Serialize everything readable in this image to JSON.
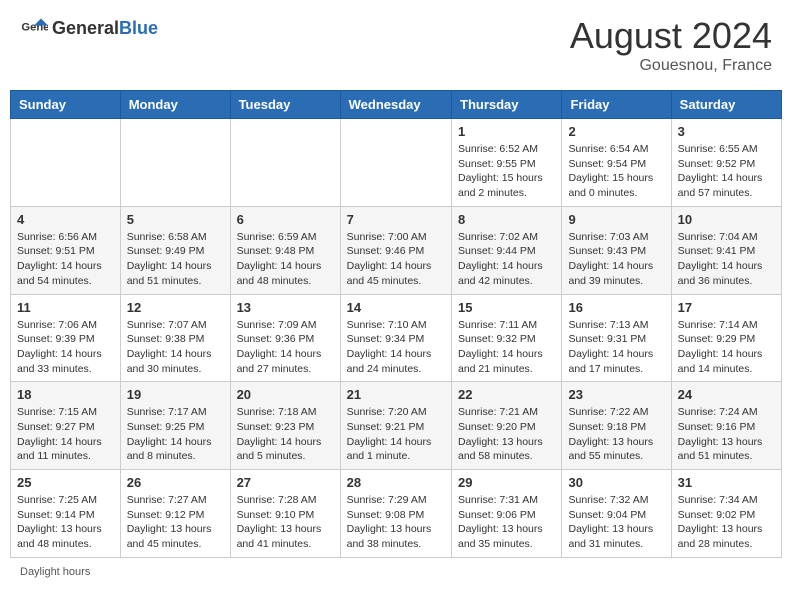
{
  "header": {
    "logo_general": "General",
    "logo_blue": "Blue",
    "month_year": "August 2024",
    "location": "Gouesnou, France"
  },
  "days_of_week": [
    "Sunday",
    "Monday",
    "Tuesday",
    "Wednesday",
    "Thursday",
    "Friday",
    "Saturday"
  ],
  "weeks": [
    [
      {
        "day": "",
        "info": ""
      },
      {
        "day": "",
        "info": ""
      },
      {
        "day": "",
        "info": ""
      },
      {
        "day": "",
        "info": ""
      },
      {
        "day": "1",
        "info": "Sunrise: 6:52 AM\nSunset: 9:55 PM\nDaylight: 15 hours and 2 minutes."
      },
      {
        "day": "2",
        "info": "Sunrise: 6:54 AM\nSunset: 9:54 PM\nDaylight: 15 hours and 0 minutes."
      },
      {
        "day": "3",
        "info": "Sunrise: 6:55 AM\nSunset: 9:52 PM\nDaylight: 14 hours and 57 minutes."
      }
    ],
    [
      {
        "day": "4",
        "info": "Sunrise: 6:56 AM\nSunset: 9:51 PM\nDaylight: 14 hours and 54 minutes."
      },
      {
        "day": "5",
        "info": "Sunrise: 6:58 AM\nSunset: 9:49 PM\nDaylight: 14 hours and 51 minutes."
      },
      {
        "day": "6",
        "info": "Sunrise: 6:59 AM\nSunset: 9:48 PM\nDaylight: 14 hours and 48 minutes."
      },
      {
        "day": "7",
        "info": "Sunrise: 7:00 AM\nSunset: 9:46 PM\nDaylight: 14 hours and 45 minutes."
      },
      {
        "day": "8",
        "info": "Sunrise: 7:02 AM\nSunset: 9:44 PM\nDaylight: 14 hours and 42 minutes."
      },
      {
        "day": "9",
        "info": "Sunrise: 7:03 AM\nSunset: 9:43 PM\nDaylight: 14 hours and 39 minutes."
      },
      {
        "day": "10",
        "info": "Sunrise: 7:04 AM\nSunset: 9:41 PM\nDaylight: 14 hours and 36 minutes."
      }
    ],
    [
      {
        "day": "11",
        "info": "Sunrise: 7:06 AM\nSunset: 9:39 PM\nDaylight: 14 hours and 33 minutes."
      },
      {
        "day": "12",
        "info": "Sunrise: 7:07 AM\nSunset: 9:38 PM\nDaylight: 14 hours and 30 minutes."
      },
      {
        "day": "13",
        "info": "Sunrise: 7:09 AM\nSunset: 9:36 PM\nDaylight: 14 hours and 27 minutes."
      },
      {
        "day": "14",
        "info": "Sunrise: 7:10 AM\nSunset: 9:34 PM\nDaylight: 14 hours and 24 minutes."
      },
      {
        "day": "15",
        "info": "Sunrise: 7:11 AM\nSunset: 9:32 PM\nDaylight: 14 hours and 21 minutes."
      },
      {
        "day": "16",
        "info": "Sunrise: 7:13 AM\nSunset: 9:31 PM\nDaylight: 14 hours and 17 minutes."
      },
      {
        "day": "17",
        "info": "Sunrise: 7:14 AM\nSunset: 9:29 PM\nDaylight: 14 hours and 14 minutes."
      }
    ],
    [
      {
        "day": "18",
        "info": "Sunrise: 7:15 AM\nSunset: 9:27 PM\nDaylight: 14 hours and 11 minutes."
      },
      {
        "day": "19",
        "info": "Sunrise: 7:17 AM\nSunset: 9:25 PM\nDaylight: 14 hours and 8 minutes."
      },
      {
        "day": "20",
        "info": "Sunrise: 7:18 AM\nSunset: 9:23 PM\nDaylight: 14 hours and 5 minutes."
      },
      {
        "day": "21",
        "info": "Sunrise: 7:20 AM\nSunset: 9:21 PM\nDaylight: 14 hours and 1 minute."
      },
      {
        "day": "22",
        "info": "Sunrise: 7:21 AM\nSunset: 9:20 PM\nDaylight: 13 hours and 58 minutes."
      },
      {
        "day": "23",
        "info": "Sunrise: 7:22 AM\nSunset: 9:18 PM\nDaylight: 13 hours and 55 minutes."
      },
      {
        "day": "24",
        "info": "Sunrise: 7:24 AM\nSunset: 9:16 PM\nDaylight: 13 hours and 51 minutes."
      }
    ],
    [
      {
        "day": "25",
        "info": "Sunrise: 7:25 AM\nSunset: 9:14 PM\nDaylight: 13 hours and 48 minutes."
      },
      {
        "day": "26",
        "info": "Sunrise: 7:27 AM\nSunset: 9:12 PM\nDaylight: 13 hours and 45 minutes."
      },
      {
        "day": "27",
        "info": "Sunrise: 7:28 AM\nSunset: 9:10 PM\nDaylight: 13 hours and 41 minutes."
      },
      {
        "day": "28",
        "info": "Sunrise: 7:29 AM\nSunset: 9:08 PM\nDaylight: 13 hours and 38 minutes."
      },
      {
        "day": "29",
        "info": "Sunrise: 7:31 AM\nSunset: 9:06 PM\nDaylight: 13 hours and 35 minutes."
      },
      {
        "day": "30",
        "info": "Sunrise: 7:32 AM\nSunset: 9:04 PM\nDaylight: 13 hours and 31 minutes."
      },
      {
        "day": "31",
        "info": "Sunrise: 7:34 AM\nSunset: 9:02 PM\nDaylight: 13 hours and 28 minutes."
      }
    ]
  ],
  "footer": {
    "daylight_label": "Daylight hours"
  }
}
